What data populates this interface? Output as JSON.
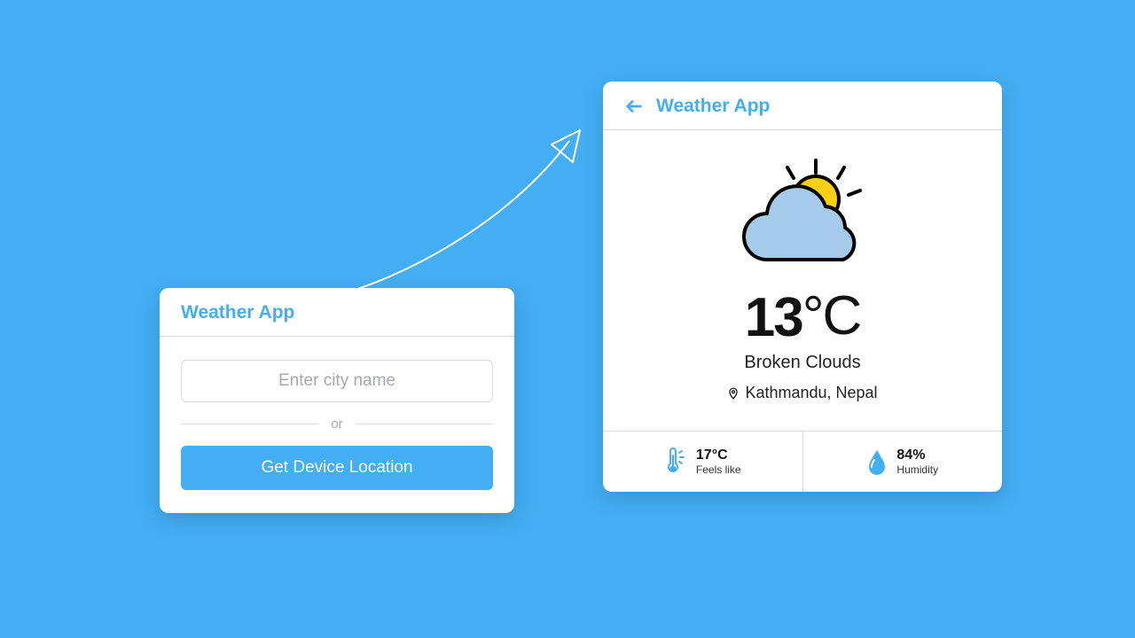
{
  "search_card": {
    "title": "Weather App",
    "city_placeholder": "Enter city name",
    "separator": "or",
    "location_button": "Get Device Location"
  },
  "result_card": {
    "title": "Weather App",
    "temperature": "13",
    "temperature_unit": "°C",
    "description": "Broken Clouds",
    "location": "Kathmandu, Nepal",
    "feels_like_value": "17°C",
    "feels_like_label": "Feels like",
    "humidity_value": "84%",
    "humidity_label": "Humidity"
  },
  "colors": {
    "accent": "#43aef4"
  }
}
